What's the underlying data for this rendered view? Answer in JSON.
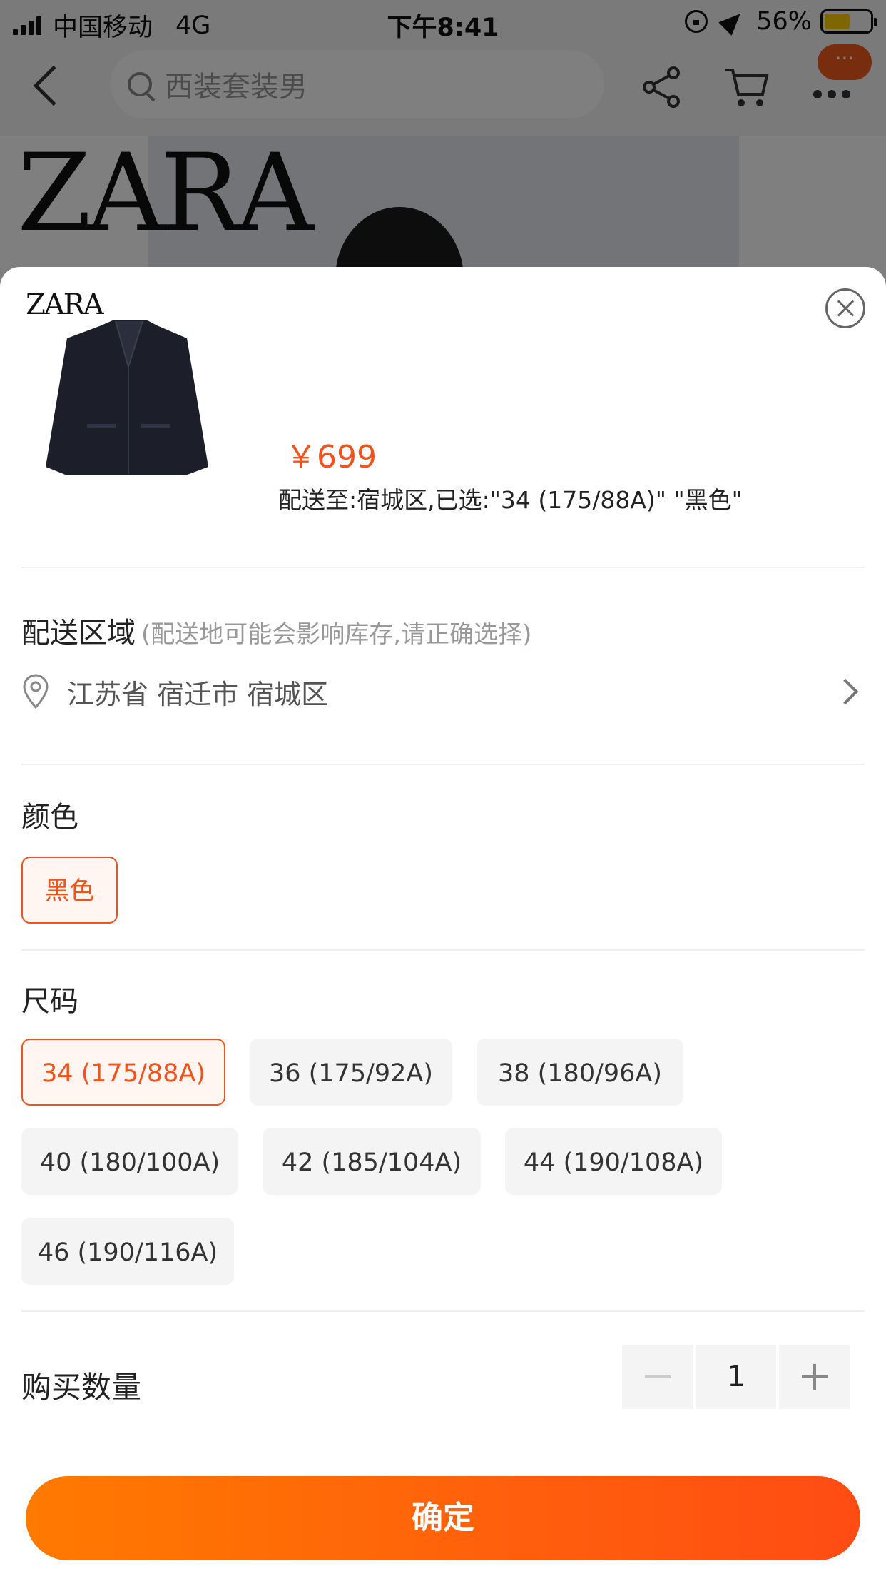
{
  "status_bar": {
    "carrier": "中国移动",
    "network": "4G",
    "time": "下午8:41",
    "battery_percent": "56%",
    "battery_level": 0.56
  },
  "nav": {
    "search_placeholder": "西装套装男",
    "message_badge": "···"
  },
  "hero": {
    "brand_logo": "ZARA"
  },
  "sheet": {
    "thumb_logo": "ZARA",
    "price": "￥699",
    "selected_info": "配送至:宿城区,已选:\"34 (175/88A)\" \"黑色\"",
    "delivery": {
      "title": "配送区域",
      "hint": "(配送地可能会影响库存,请正确选择)",
      "address": "江苏省 宿迁市 宿城区"
    },
    "color": {
      "title": "颜色",
      "options": [
        {
          "label": "黑色",
          "selected": true
        }
      ]
    },
    "size": {
      "title": "尺码",
      "options": [
        {
          "label": "34 (175/88A)",
          "selected": true
        },
        {
          "label": "36 (175/92A)",
          "selected": false
        },
        {
          "label": "38 (180/96A)",
          "selected": false
        },
        {
          "label": "40 (180/100A)",
          "selected": false
        },
        {
          "label": "42 (185/104A)",
          "selected": false
        },
        {
          "label": "44 (190/108A)",
          "selected": false
        },
        {
          "label": "46 (190/116A)",
          "selected": false
        }
      ]
    },
    "quantity": {
      "label": "购买数量",
      "value": "1"
    },
    "confirm_label": "确定"
  },
  "colors": {
    "accent": "#f2521c",
    "button_start": "#ff7a00",
    "button_end": "#ff4c14"
  }
}
